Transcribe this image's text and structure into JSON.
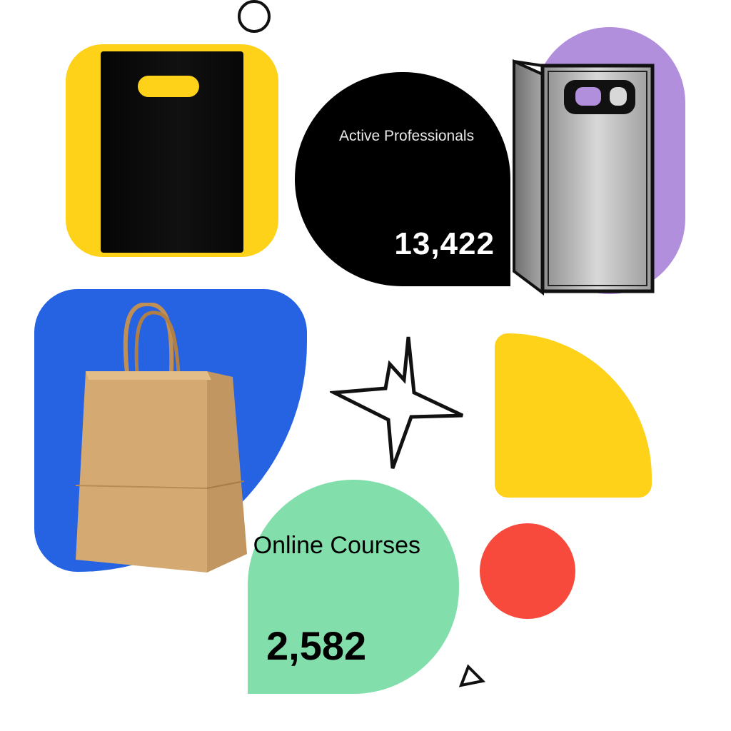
{
  "stats": {
    "professionals": {
      "label": "Active Professionals",
      "value": "13,422"
    },
    "courses": {
      "label": "Online Courses",
      "value": "2,582"
    }
  },
  "colors": {
    "yellow": "#FFD21A",
    "blue": "#2563E3",
    "purple": "#B18FDD",
    "green": "#82DEAB",
    "red": "#F84A3C",
    "black": "#000000"
  },
  "icons": [
    "black-shopping-bag-icon",
    "grey-shopping-bag-icon",
    "kraft-paper-bag-icon",
    "sparkle-star-icon",
    "outline-circle-icon",
    "outline-triangle-icon"
  ]
}
